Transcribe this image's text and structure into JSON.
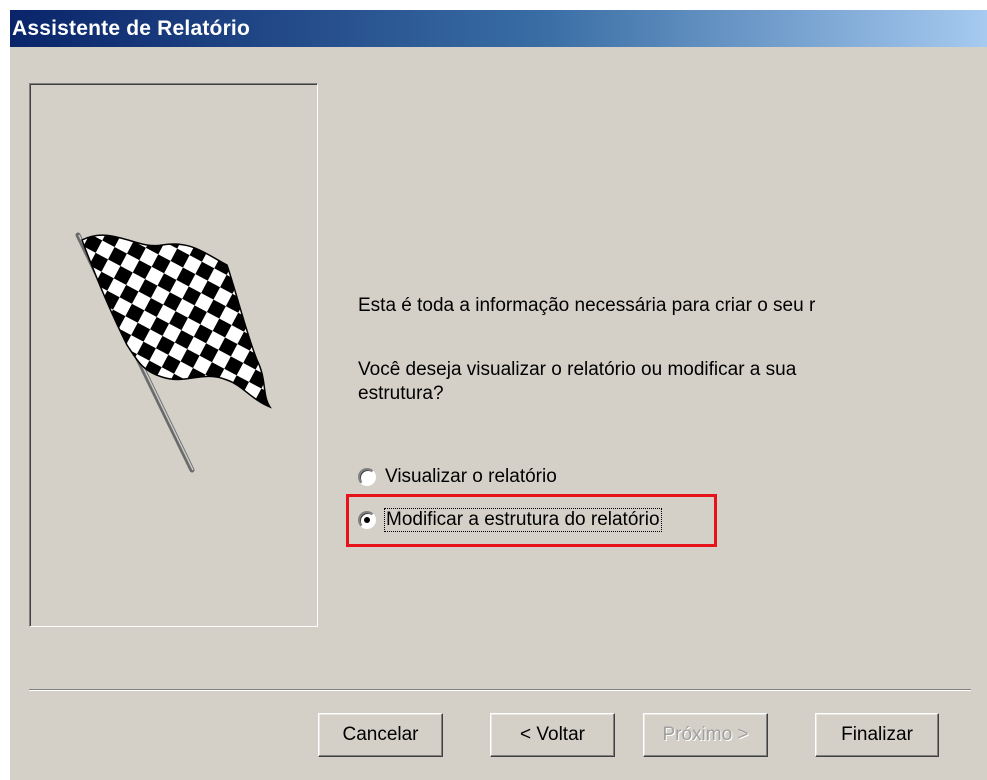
{
  "window": {
    "title": "Assistente de Relatório"
  },
  "content": {
    "info_text": "Esta é toda a informação necessária para criar o seu r",
    "question_text": "Você deseja visualizar o relatório ou modificar a sua estrutura?"
  },
  "options": [
    {
      "label": "Visualizar o relatório",
      "selected": false
    },
    {
      "label": "Modificar a estrutura do relatório",
      "selected": true
    }
  ],
  "highlight_color": "#e8131a",
  "buttons": {
    "cancel": "Cancelar",
    "back": "< Voltar",
    "next": "Próximo >",
    "finish": "Finalizar"
  },
  "icons": {
    "wizard_image": "checkered-flag-icon"
  }
}
